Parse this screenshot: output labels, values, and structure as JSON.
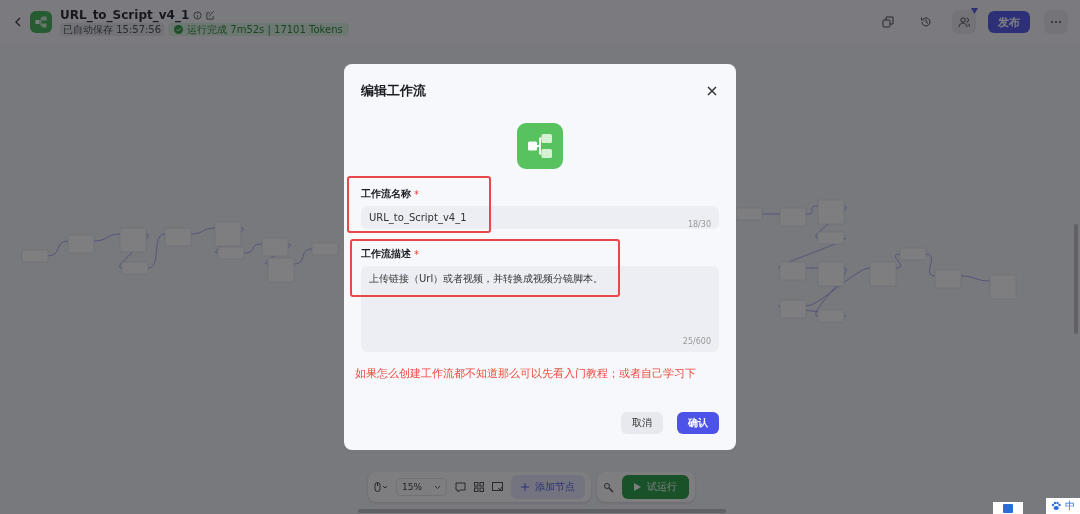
{
  "header": {
    "title": "URL_to_Script_v4_1",
    "autosave": "已自动保存 15:57:56",
    "run_status": "运行完成 7m52s | 17101 Tokens",
    "publish": "发布"
  },
  "toolbar": {
    "zoom": "15%",
    "add_node": "添加节点",
    "test_run": "试运行"
  },
  "modal": {
    "title": "编辑工作流",
    "fields": [
      {
        "kind": "single",
        "label": "工作流名称",
        "required_mark": "*",
        "value": "URL_to_Script_v4_1",
        "counter": "18/30"
      },
      {
        "kind": "multi",
        "label": "工作流描述",
        "required_mark": "*",
        "value": "上传链接（Url）或者视频，并转换成视频分镜脚本。",
        "counter": "25/600"
      }
    ],
    "note": "如果怎么创建工作流都不知道那么可以先看入门教程；或者自己学习下",
    "cancel": "取消",
    "confirm": "确认"
  },
  "ime": {
    "mode": "中"
  }
}
